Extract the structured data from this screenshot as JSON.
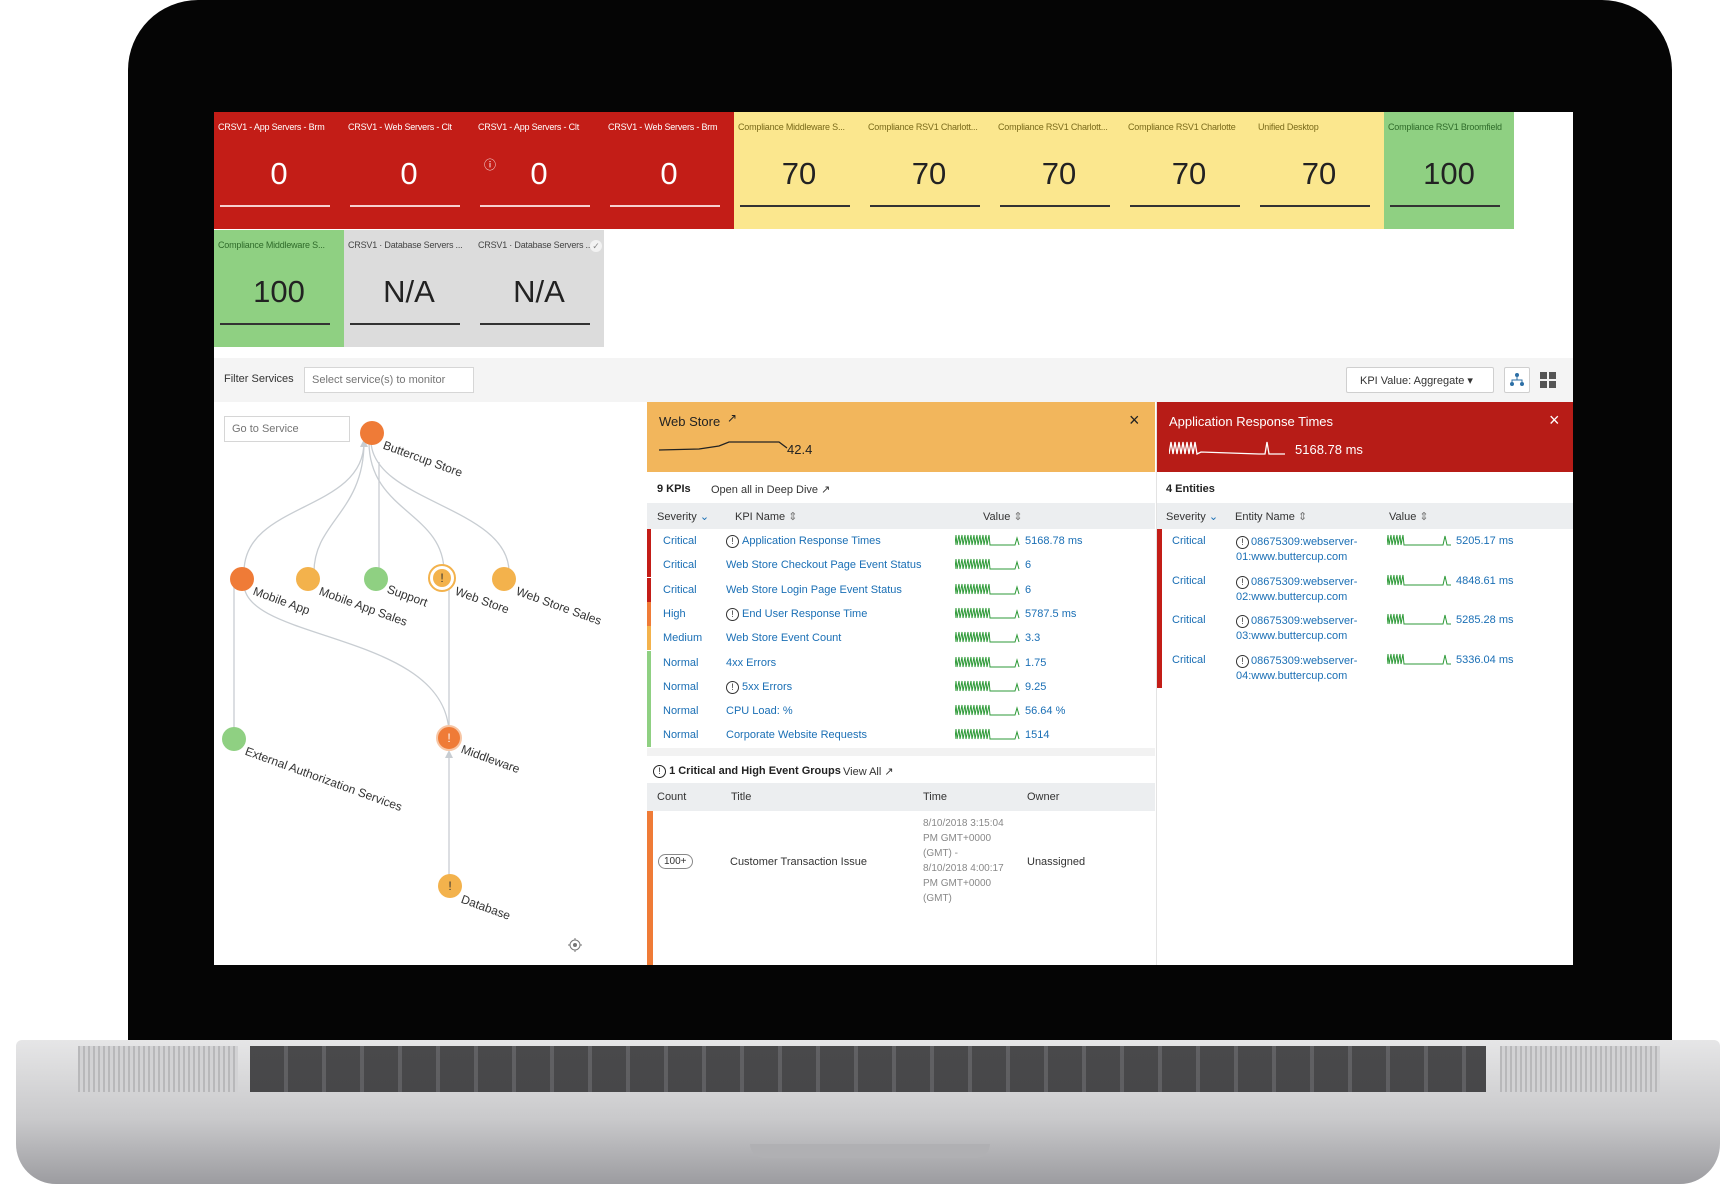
{
  "tiles_row1": [
    {
      "name": "CRSV1 - App Servers - Brm",
      "value": "0",
      "color": "red"
    },
    {
      "name": "CRSV1 - Web Servers - Clt",
      "value": "0",
      "color": "red"
    },
    {
      "name": "CRSV1 - App Servers - Clt",
      "value": "0",
      "color": "red",
      "badge": "!"
    },
    {
      "name": "CRSV1 - Web Servers - Brm",
      "value": "0",
      "color": "red"
    },
    {
      "name": "Compliance Middleware S...",
      "value": "70",
      "color": "yellow"
    },
    {
      "name": "Compliance RSV1 Charlott...",
      "value": "70",
      "color": "yellow"
    },
    {
      "name": "Compliance RSV1 Charlott...",
      "value": "70",
      "color": "yellow"
    },
    {
      "name": "Compliance RSV1 Charlotte",
      "value": "70",
      "color": "yellow"
    },
    {
      "name": "Unified Desktop",
      "value": "70",
      "color": "yellow"
    },
    {
      "name": "Compliance RSV1 Broomfield",
      "value": "100",
      "color": "green"
    }
  ],
  "tiles_row2": [
    {
      "name": "Compliance Middleware S...",
      "value": "100",
      "color": "green"
    },
    {
      "name": "CRSV1 · Database Servers ...",
      "value": "N/A",
      "color": "gray"
    },
    {
      "name": "CRSV1 · Database Servers ...",
      "value": "N/A",
      "color": "gray",
      "check": true
    }
  ],
  "filter": {
    "label": "Filter Services",
    "placeholder": "Select service(s) to monitor",
    "kpi_value_label": "KPI Value: Aggregate ▾"
  },
  "topology": {
    "go_to_placeholder": "Go to Service",
    "nodes": [
      {
        "label": "Buttercup Store",
        "status": "critical"
      },
      {
        "label": "Mobile App",
        "status": "critical"
      },
      {
        "label": "Mobile App Sales",
        "status": "high"
      },
      {
        "label": "Support",
        "status": "normal"
      },
      {
        "label": "Web Store",
        "status": "high"
      },
      {
        "label": "Web Store Sales",
        "status": "high"
      },
      {
        "label": "Middleware",
        "status": "critical"
      },
      {
        "label": "External Authorization Services",
        "status": "normal"
      },
      {
        "label": "Database",
        "status": "high"
      }
    ]
  },
  "webstore": {
    "title": "Web Store",
    "value": "42.4",
    "kpi_count": "9 KPIs",
    "deep_dive": "Open all in Deep Dive",
    "columns": [
      "Severity",
      "KPI Name",
      "Value"
    ],
    "rows": [
      {
        "severity": "Critical",
        "name": "Application Response Times",
        "value": "5168.78 ms",
        "alert": true
      },
      {
        "severity": "Critical",
        "name": "Web Store Checkout Page Event Status",
        "value": "6"
      },
      {
        "severity": "Critical",
        "name": "Web Store Login Page Event Status",
        "value": "6"
      },
      {
        "severity": "High",
        "name": "End User Response Time",
        "value": "5787.5 ms",
        "alert": true
      },
      {
        "severity": "Medium",
        "name": "Web Store Event Count",
        "value": "3.3"
      },
      {
        "severity": "Normal",
        "name": "4xx Errors",
        "value": "1.75"
      },
      {
        "severity": "Normal",
        "name": "5xx Errors",
        "value": "9.25",
        "alert": true
      },
      {
        "severity": "Normal",
        "name": "CPU Load: %",
        "value": "56.64 %"
      },
      {
        "severity": "Normal",
        "name": "Corporate Website Requests",
        "value": "1514"
      }
    ],
    "events": {
      "title": "1 Critical and High Event Groups",
      "view_all": "View All",
      "columns": [
        "Count",
        "Title",
        "Time",
        "Owner"
      ],
      "row": {
        "count": "100+",
        "title": "Customer Transaction Issue",
        "time": [
          "8/10/2018 3:15:04",
          "PM GMT+0000",
          "(GMT) -",
          "8/10/2018 4:00:17",
          "PM GMT+0000",
          "(GMT)"
        ],
        "owner": "Unassigned"
      }
    }
  },
  "art": {
    "title": "Application Response Times",
    "value": "5168.78 ms",
    "entity_count": "4 Entities",
    "columns": [
      "Severity",
      "Entity Name",
      "Value"
    ],
    "rows": [
      {
        "severity": "Critical",
        "line1": "08675309:webserver-",
        "line2": "01:www.buttercup.com",
        "value": "5205.17 ms"
      },
      {
        "severity": "Critical",
        "line1": "08675309:webserver-",
        "line2": "02:www.buttercup.com",
        "value": "4848.61 ms"
      },
      {
        "severity": "Critical",
        "line1": "08675309:webserver-",
        "line2": "03:www.buttercup.com",
        "value": "5285.28 ms"
      },
      {
        "severity": "Critical",
        "line1": "08675309:webserver-",
        "line2": "04:www.buttercup.com",
        "value": "5336.04 ms"
      }
    ]
  },
  "colors": {
    "critical": "#c31d17",
    "high": "#ef7b37",
    "medium": "#f3b24c",
    "normal": "#8fd082",
    "link": "#1a6fb5",
    "webstore_header": "#f2b65c",
    "art_header": "#b71c17"
  },
  "icons": [
    "alert-icon",
    "external-link-icon",
    "close-icon",
    "sort-icon",
    "topology-view-icon",
    "tile-view-icon",
    "recenter-icon",
    "check-icon"
  ]
}
